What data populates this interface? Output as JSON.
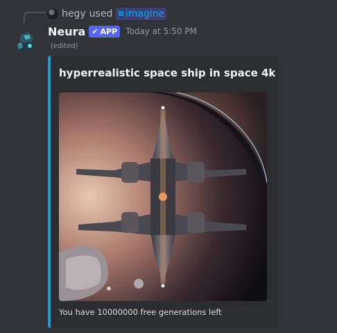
{
  "reply": {
    "user": "hegy",
    "verb": "used",
    "command": "imagine",
    "command_icon": "slash-command-icon"
  },
  "message": {
    "author": "Neura",
    "badge": "APP",
    "badge_icon": "verified-check-icon",
    "timestamp": "Today at 5:50 PM",
    "edited": "(edited)"
  },
  "embed": {
    "accent_color": "#1d9bd1",
    "title": "hyperrealistic space ship in space 4k",
    "image": "generated-spaceship-image",
    "footer": "You have 10000000 free generations left"
  }
}
